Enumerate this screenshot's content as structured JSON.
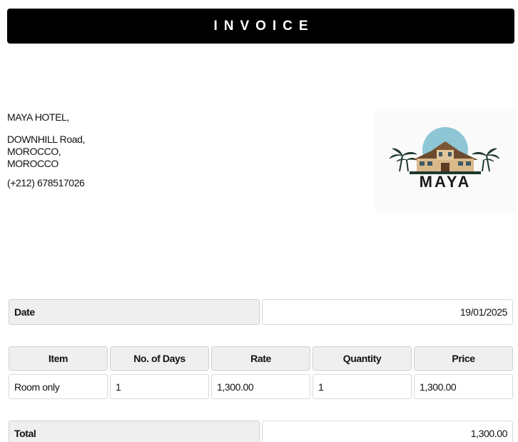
{
  "header": {
    "title": "INVOICE"
  },
  "hotel": {
    "name_line": "MAYA HOTEL,",
    "address_lines": [
      "DOWNHILL Road,",
      "MOROCCO,",
      "MOROCCO"
    ],
    "phone": "(+212) 678517026",
    "logo_text": "MAYA"
  },
  "date_row": {
    "label": "Date",
    "value": "19/01/2025"
  },
  "items_table": {
    "headers": [
      "Item",
      "No. of Days",
      "Rate",
      "Quantity",
      "Price"
    ],
    "rows": [
      [
        "Room only",
        "1",
        "1,300.00",
        "1",
        "1,300.00"
      ]
    ]
  },
  "total_row": {
    "label": "Total",
    "value": "1,300.00"
  },
  "colors": {
    "title_bg": "#000000",
    "label_bg": "#efefef",
    "logo_sky": "#8fc6d6",
    "logo_palm": "#1f3a2e"
  }
}
